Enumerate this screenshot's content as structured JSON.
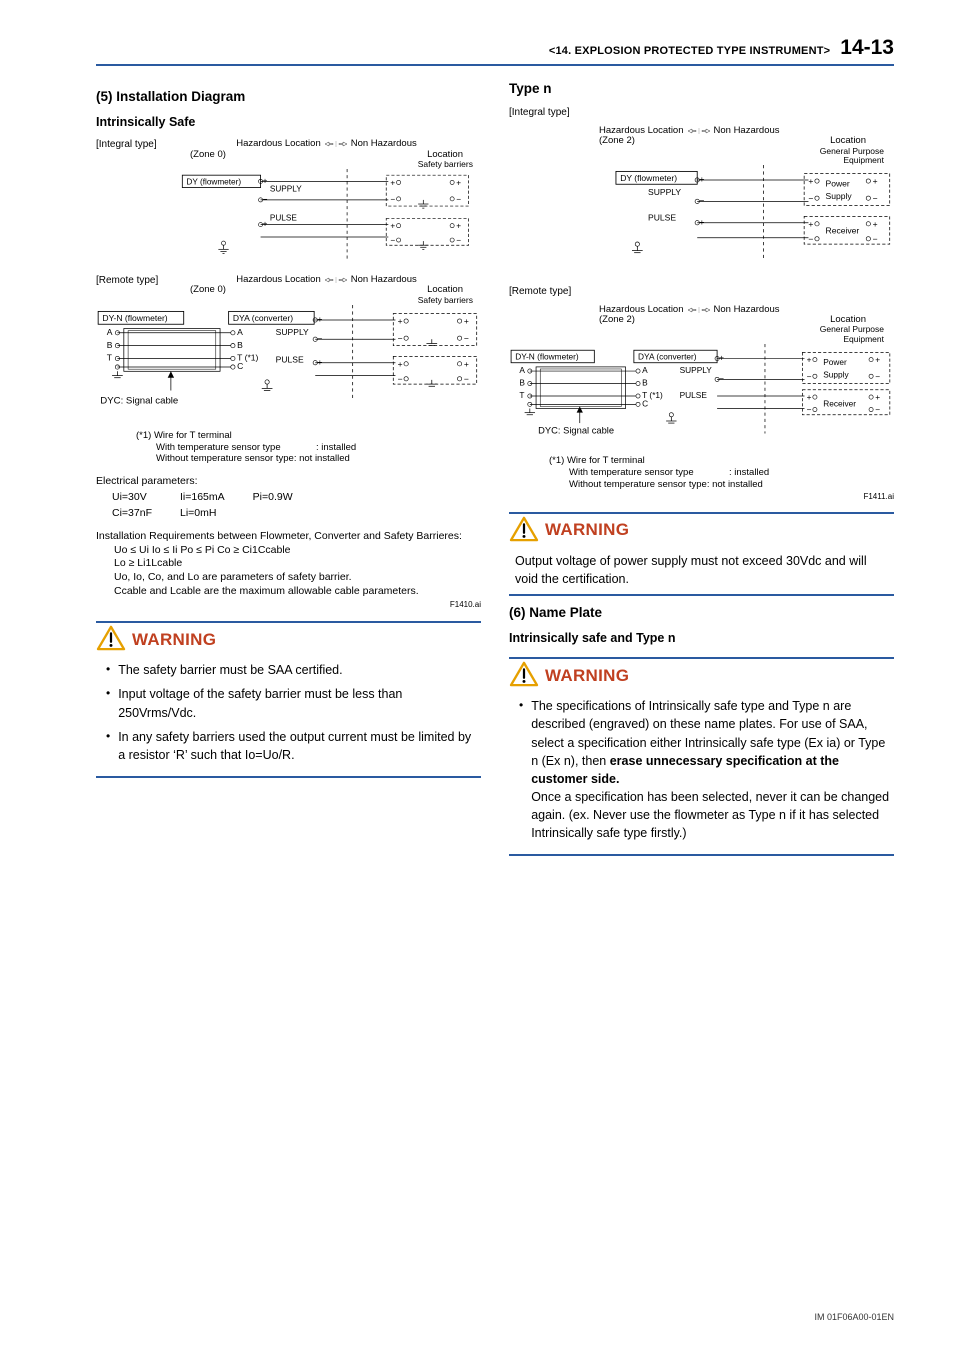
{
  "header": {
    "chapter": "<14.  EXPLOSION PROTECTED TYPE INSTRUMENT>",
    "page": "14-13"
  },
  "left": {
    "section5_title": "(5)  Installation Diagram",
    "is_title": "Intrinsically Safe",
    "integral_label": "[Integral type]",
    "remote_label": "[Remote type]",
    "haz_loc": "Hazardous Location",
    "zone0": "(Zone 0)",
    "nonhaz": "Non Hazardous",
    "location": "Location",
    "safety_barriers": "Safety barriers",
    "dy_flow": "DY (flowmeter)",
    "supply": "SUPPLY",
    "pulse": "PULSE",
    "dyn_flow": "DY-N (flowmeter)",
    "dya_conv": "DYA (converter)",
    "termA": "A",
    "termB": "B",
    "termT": "T",
    "termC": "C",
    "t_star": "T (*1)",
    "dyc_cable": "DYC: Signal cable",
    "wire_note_title": "(*1) Wire for T terminal",
    "wire_note_with": "With temperature sensor type",
    "wire_note_with_val": ": installed",
    "wire_note_without": "Without temperature sensor type: not installed",
    "elec_params_title": "Electrical parameters:",
    "Ui": "Ui=30V",
    "Ii": "Ii=165mA",
    "Pi": "Pi=0.9W",
    "Ci": "Ci=37nF",
    "Li": "Li=0mH",
    "req_title": "Installation Requirements between Flowmeter, Converter and Safety Barrieres:",
    "req_line1": "Uo ≤ Ui   Io ≤ Ii   Po ≤ Pi   Co ≥ Ci1Ccable",
    "req_line2": "Lo ≥ Li1Lcable",
    "req_line3": "Uo, Io, Co, and Lo are parameters of safety barrier.",
    "req_line4": "Ccable and Lcable are the maximum allowable cable parameters.",
    "fig_id": "F1410.ai",
    "warn_title": "WARNING",
    "warn_b1": "The safety barrier must be SAA certified.",
    "warn_b2": "Input voltage of the safety barrier must be less than 250Vrms/Vdc.",
    "warn_b3": "In any safety barriers used the output current must be limited by a resistor ‘R’ such that Io=Uo/R."
  },
  "right": {
    "type_n_title": "Type n",
    "integral_label": "[Integral type]",
    "remote_label": "[Remote type]",
    "haz_loc": "Hazardous Location",
    "zone2": "(Zone 2)",
    "nonhaz": "Non Hazardous",
    "location": "Location",
    "gpe_line1": "General Purpose",
    "gpe_line2": "Equipment",
    "power": "Power",
    "supply_s": "Supply",
    "receiver": "Receiver",
    "dy_flow": "DY (flowmeter)",
    "supply": "SUPPLY",
    "pulse": "PULSE",
    "dyn_flow": "DY-N (flowmeter)",
    "dya_conv": "DYA (converter)",
    "termA": "A",
    "termB": "B",
    "termT": "T",
    "termC": "C",
    "t_star": "T (*1)",
    "dyc_cable": "DYC: Signal cable",
    "wire_note_title": "(*1) Wire for T terminal",
    "wire_note_with": "With temperature sensor type",
    "wire_note_with_val": ": installed",
    "wire_note_without": "Without temperature sensor type: not installed",
    "fig_id": "F1411.ai",
    "warn1_title": "WARNING",
    "warn1_text": "Output voltage of power supply must not exceed 30Vdc and will void the certification.",
    "section6_title": "(6)  Name Plate",
    "is_typen_title": "Intrinsically safe and Type n",
    "warn2_title": "WARNING",
    "warn2_p1a": "The specifications of Intrinsically safe type and Type n are described (engraved) on these name plates. For use of SAA, select a specification either Intrinsically safe type (Ex ia) or Type n (Ex n), then ",
    "warn2_p1b_bold": "erase unnecessary specification at the customer side.",
    "warn2_p2": "Once a specification has been selected, never it can be changed again. (ex. Never use the flowmeter as Type n if it has selected Intrinsically safe type firstly.)"
  },
  "footer": {
    "doc_id": "IM 01F06A00-01EN"
  }
}
